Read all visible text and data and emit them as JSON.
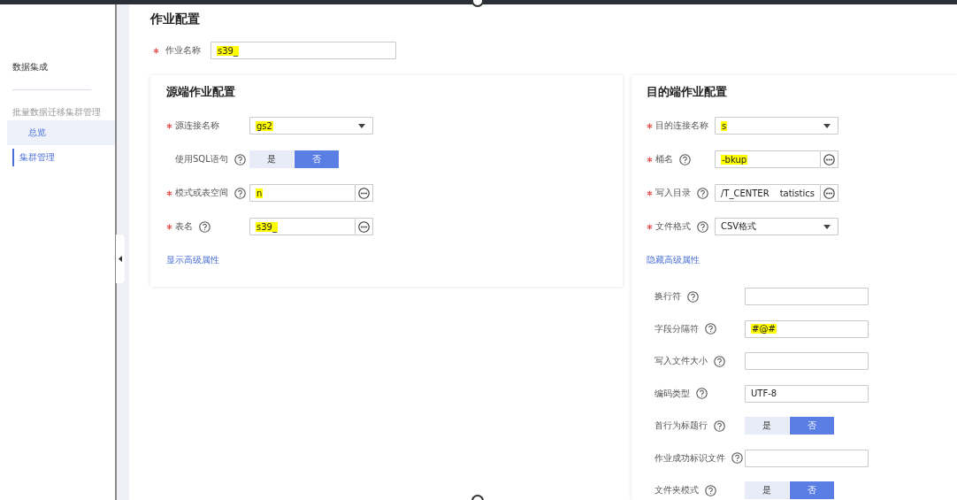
{
  "title": "作业配置",
  "sidebar": {
    "title": "数据集成",
    "section": "批量数据迁移集群管理",
    "items": [
      {
        "label": "总览",
        "selected": false,
        "hovered": true
      },
      {
        "label": "集群管理",
        "selected": true,
        "hovered": false
      }
    ]
  },
  "job_name": {
    "label": "作业名称",
    "required": true,
    "value": "s39_",
    "highlight": true
  },
  "source": {
    "title": "源端作业配置",
    "fields": [
      {
        "kind": "select",
        "label": "源连接名称",
        "required": true,
        "help": false,
        "value": "gs2",
        "highlight": true
      },
      {
        "kind": "toggle",
        "label": "使用SQL语句",
        "required": false,
        "help": true,
        "options": [
          {
            "label": "是",
            "selected": false
          },
          {
            "label": "否",
            "selected": true
          }
        ]
      },
      {
        "kind": "browse",
        "label": "模式或表空间",
        "required": true,
        "help": true,
        "value": "n",
        "highlight": true
      },
      {
        "kind": "browse",
        "label": "表名",
        "required": true,
        "help": true,
        "value": "s39_",
        "highlight": true
      }
    ],
    "link": "显示高级属性"
  },
  "target": {
    "title": "目的端作业配置",
    "fields": [
      {
        "kind": "select",
        "label": "目的连接名称",
        "required": true,
        "help": false,
        "value": "s",
        "highlight": true
      },
      {
        "kind": "browse",
        "label": "桶名",
        "required": true,
        "help": true,
        "value": "-bkup",
        "highlight": true
      },
      {
        "kind": "browse",
        "label": "写入目录",
        "required": true,
        "help": true,
        "value": "/T_CENTER",
        "value_end": "tatistics",
        "highlight": false
      },
      {
        "kind": "select",
        "label": "文件格式",
        "required": true,
        "help": true,
        "value": "CSV格式",
        "highlight": false
      }
    ],
    "link": "隐藏高级属性",
    "advanced_fields": [
      {
        "kind": "input",
        "label": "换行符",
        "required": false,
        "help": true
      },
      {
        "kind": "input",
        "label": "字段分隔符",
        "required": false,
        "help": true,
        "value": "#@#",
        "highlight": true
      },
      {
        "kind": "input",
        "label": "写入文件大小",
        "required": false,
        "help": true
      },
      {
        "kind": "input",
        "label": "编码类型",
        "required": false,
        "help": true,
        "value": "UTF-8",
        "highlight": false
      },
      {
        "kind": "toggle",
        "label": "首行为标题行",
        "required": false,
        "help": true,
        "options": [
          {
            "label": "是",
            "selected": false
          },
          {
            "label": "否",
            "selected": true
          }
        ]
      },
      {
        "kind": "input",
        "label": "作业成功标识文件",
        "required": false,
        "help": true
      },
      {
        "kind": "toggle",
        "label": "文件夹模式",
        "required": false,
        "help": true,
        "options": [
          {
            "label": "是",
            "selected": false
          },
          {
            "label": "否",
            "selected": true
          }
        ]
      }
    ]
  }
}
